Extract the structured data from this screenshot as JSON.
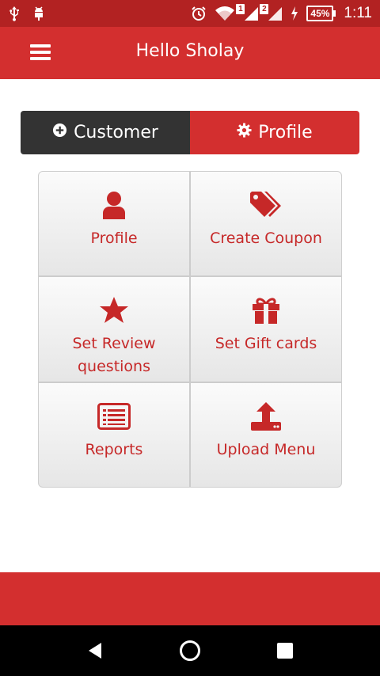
{
  "status_bar": {
    "time": "1:11",
    "battery": "45%",
    "sim2_label": "1",
    "sim2b_label": "2",
    "icons": [
      "usb-icon",
      "android-debug-icon",
      "alarm-icon",
      "wifi-icon",
      "signal-icon",
      "signal-icon",
      "charging-icon",
      "battery-icon"
    ]
  },
  "header": {
    "title": "Hello Sholay",
    "menu_icon": "hamburger-icon"
  },
  "segment": {
    "customer_label": "Customer",
    "profile_label": "Profile",
    "customer_icon": "plus-circle-icon",
    "profile_icon": "gear-icon"
  },
  "tiles": [
    {
      "label": "Profile",
      "icon": "user-icon"
    },
    {
      "label": "Create Coupon",
      "icon": "tags-icon"
    },
    {
      "label": "Set Review questions",
      "icon": "star-icon"
    },
    {
      "label": "Set Gift cards",
      "icon": "gift-icon"
    },
    {
      "label": "Reports",
      "icon": "list-alt-icon"
    },
    {
      "label": "Upload Menu",
      "icon": "upload-icon"
    }
  ],
  "colors": {
    "status_bar": "#b22222",
    "brand_red": "#d32f2f",
    "segment_dark": "#333333",
    "tile_text": "#c62828"
  },
  "nav_bar": {
    "back_icon": "back-triangle-icon",
    "home_icon": "home-circle-icon",
    "recents_icon": "recents-square-icon"
  }
}
